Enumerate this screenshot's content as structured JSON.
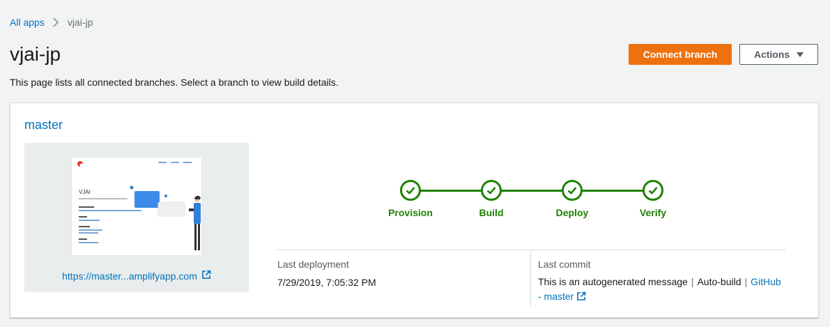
{
  "breadcrumb": {
    "root": "All apps",
    "current": "vjai-jp"
  },
  "page": {
    "title": "vjai-jp",
    "description": "This page lists all connected branches. Select a branch to view build details."
  },
  "header_actions": {
    "connect_branch_label": "Connect branch",
    "actions_label": "Actions"
  },
  "branch": {
    "name": "master",
    "url": "https://master...amplifyapp.com",
    "pipeline": [
      {
        "label": "Provision",
        "status": "success"
      },
      {
        "label": "Build",
        "status": "success"
      },
      {
        "label": "Deploy",
        "status": "success"
      },
      {
        "label": "Verify",
        "status": "success"
      }
    ],
    "last_deployment": {
      "label": "Last deployment",
      "value": "7/29/2019, 7:05:32 PM"
    },
    "last_commit": {
      "label": "Last commit",
      "message": "This is an autogenerated message",
      "source": "Auto-build",
      "link_line1": "GitHub",
      "link_line2": "- master"
    },
    "thumbnail": {
      "site_title": "VJAI"
    }
  },
  "colors": {
    "accent": "#ec7211",
    "link": "#0073bb",
    "success": "#1d8102",
    "background": "#f2f3f3"
  }
}
